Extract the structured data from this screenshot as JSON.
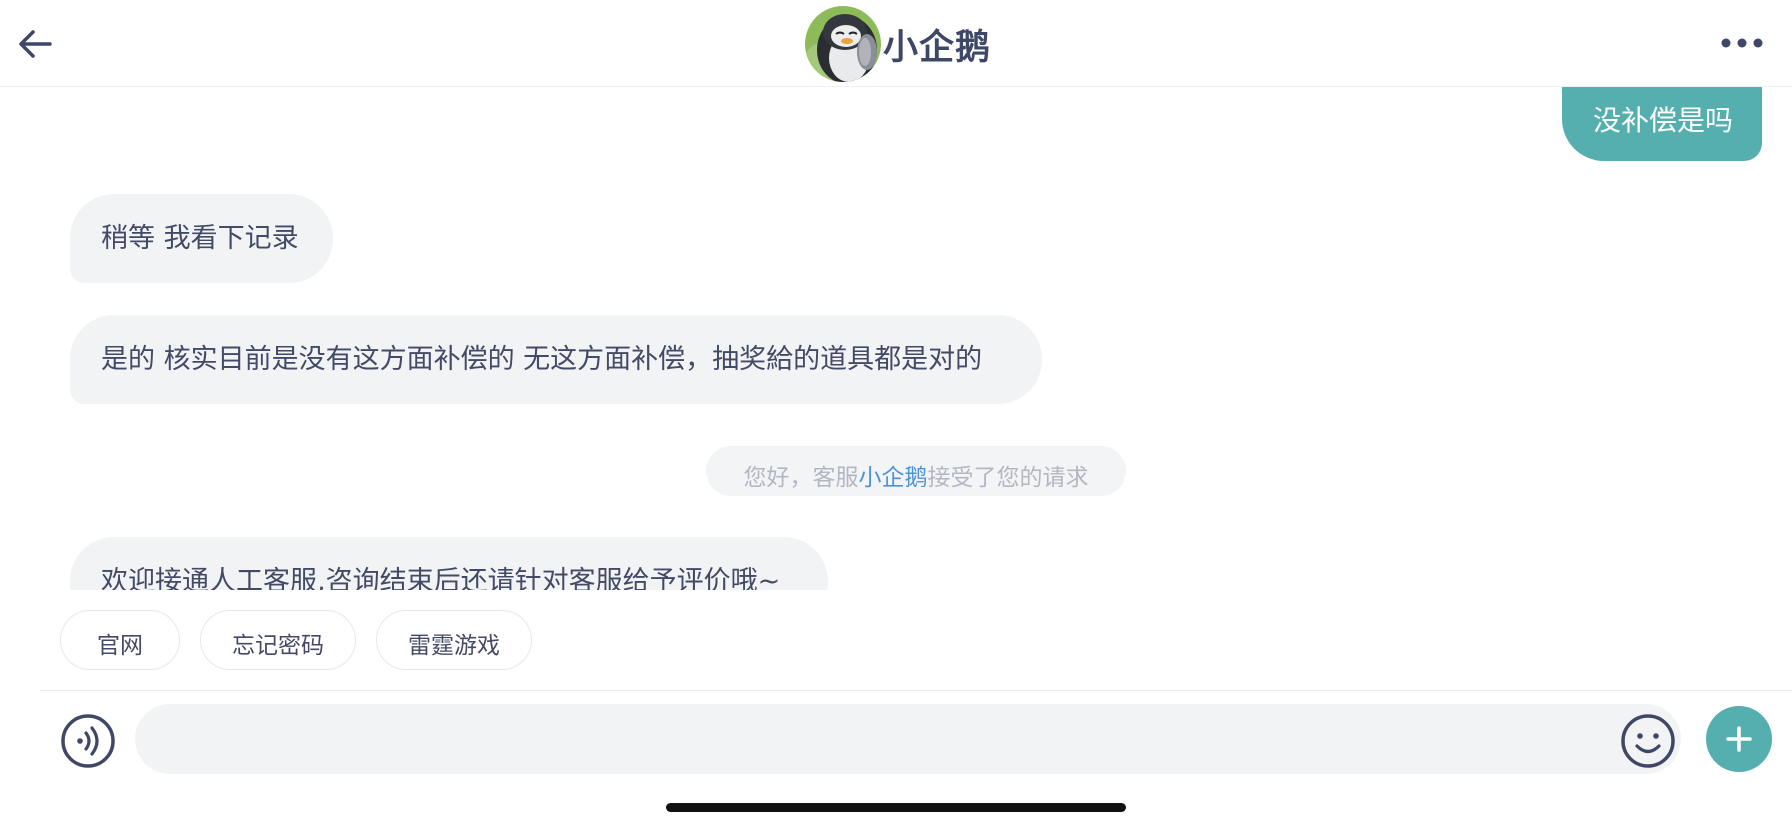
{
  "header": {
    "title": "小企鹅",
    "back_icon": "arrow-left-icon",
    "more_icon": "more-horizontal-icon",
    "avatar": "penguin-avatar"
  },
  "messages": [
    {
      "side": "outgoing",
      "text": "没补偿是吗"
    },
    {
      "side": "incoming",
      "text": "稍等 我看下记录"
    },
    {
      "side": "incoming",
      "text": "是的 核实目前是没有这方面补偿的 无这方面补偿，抽奖給的道具都是对的"
    },
    {
      "side": "incoming",
      "text": "欢迎接通人工客服,咨询结束后还请针对客服给予评价哦~"
    }
  ],
  "system_notice": {
    "prefix": "您好，客服",
    "agent": "小企鹅",
    "suffix": "接受了您的请求"
  },
  "quick_replies": [
    "官网",
    "忘记密码",
    "雷霆游戏"
  ],
  "input": {
    "value": "",
    "placeholder": "",
    "voice_icon": "voice-icon",
    "emoji_icon": "emoji-icon",
    "plus_icon": "plus-icon"
  },
  "colors": {
    "accent": "#56afaf",
    "text": "#3f4766",
    "bubble_in": "#f2f3f5",
    "notice_text": "#b3b7c2",
    "notice_highlight": "#4f92d9"
  }
}
